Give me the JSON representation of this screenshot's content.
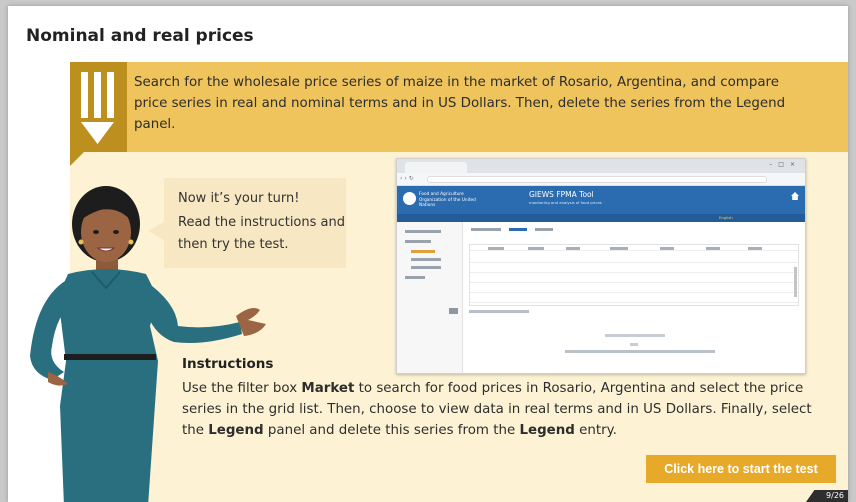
{
  "slide": {
    "title": "Nominal and real prices",
    "task_text": "Search for the wholesale price series of maize in the market of Rosario, Argentina, and compare price series in real and nominal terms and in US Dollars. Then, delete the series from the Legend panel.",
    "bubble_line1": "Now it’s your turn!",
    "bubble_line2": "Read the instructions and then try the test.",
    "instructions_heading": "Instructions",
    "instructions": {
      "p1": "Use the filter box ",
      "b1": "Market",
      "p2": " to search for food prices in Rosario, Argentina and select the price series in the grid list. Then, choose to view data in real terms and in US Dollars. Finally, select the ",
      "b2": "Legend",
      "p3": " panel and delete this series from the ",
      "b3": "Legend",
      "p4": " entry."
    },
    "start_button": "Click here to start the test",
    "page_counter": "9/26"
  },
  "screenshot": {
    "app_title": "GIEWS FPMA Tool",
    "app_subtitle": "monitoring and analysis of food prices",
    "org_name": "Food and Agriculture Organization of the United Nations",
    "language_active": "English"
  },
  "colors": {
    "banner": "#efc45c",
    "content_bg": "#fdf3d4",
    "pencil_box": "#bd8f1f",
    "button": "#e7a92a",
    "app_header": "#2b6cb0"
  },
  "icons": [
    "pencil-icon",
    "home-icon"
  ]
}
